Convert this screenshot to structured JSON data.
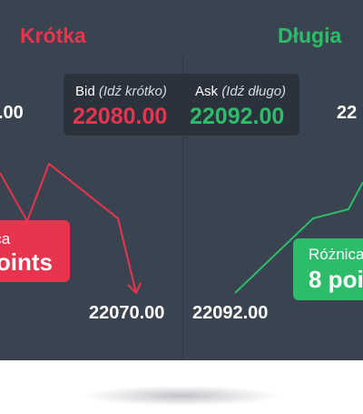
{
  "short_side": {
    "title": "Krótka",
    "partial_price": ".00",
    "diff_label": "nica",
    "diff_value": "points",
    "end_price": "22070.00"
  },
  "long_side": {
    "title": "Długia",
    "partial_price": "22",
    "diff_label": "Różnica",
    "diff_value": "8 poi",
    "start_price": "22092.00"
  },
  "ticker": {
    "bid_label": "Bid",
    "bid_hint": "(Idź krótko)",
    "bid_value": "22080.00",
    "ask_label": "Ask",
    "ask_hint": "(Idź długo)",
    "ask_value": "22092.00"
  },
  "colors": {
    "short": "#e8344e",
    "long": "#2dbd6a",
    "panel": "#3a4350",
    "ticker_bg": "#2b323c"
  }
}
